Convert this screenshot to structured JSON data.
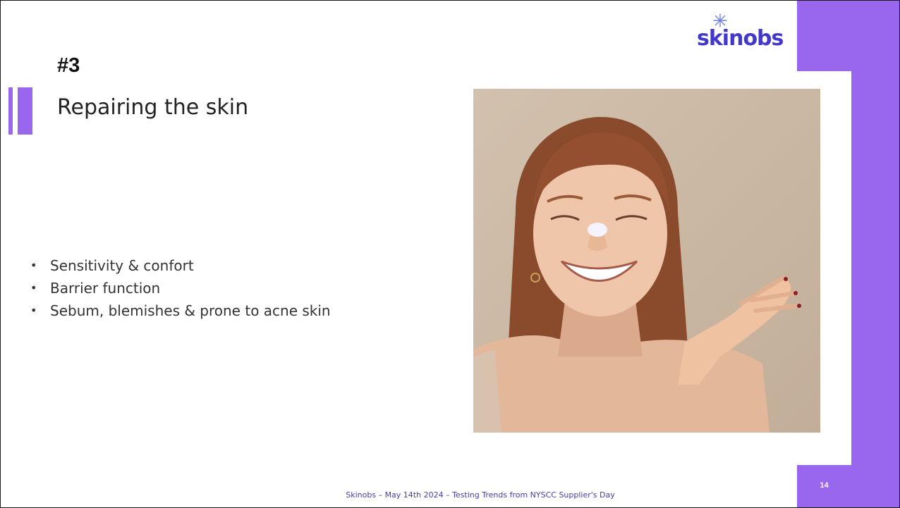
{
  "slide": {
    "number_heading": "#3",
    "title": "Repairing the skin",
    "bullets": [
      "Sensitivity & confort",
      "Barrier function",
      "Sebum, blemishes & prone to acne skin"
    ],
    "footer": "Skinobs – May 14th 2024 – Testing Trends from NYSCC Supplier's Day",
    "page_number": "14"
  },
  "logo": {
    "text": "skinobs",
    "icon": "snowflake-star-icon"
  },
  "photo": {
    "icon": "woman-smiling-with-cream-on-nose-photo"
  },
  "colors": {
    "accent": "#9966ee",
    "logo": "#4338ca",
    "footer_text": "#4a3aa8"
  }
}
